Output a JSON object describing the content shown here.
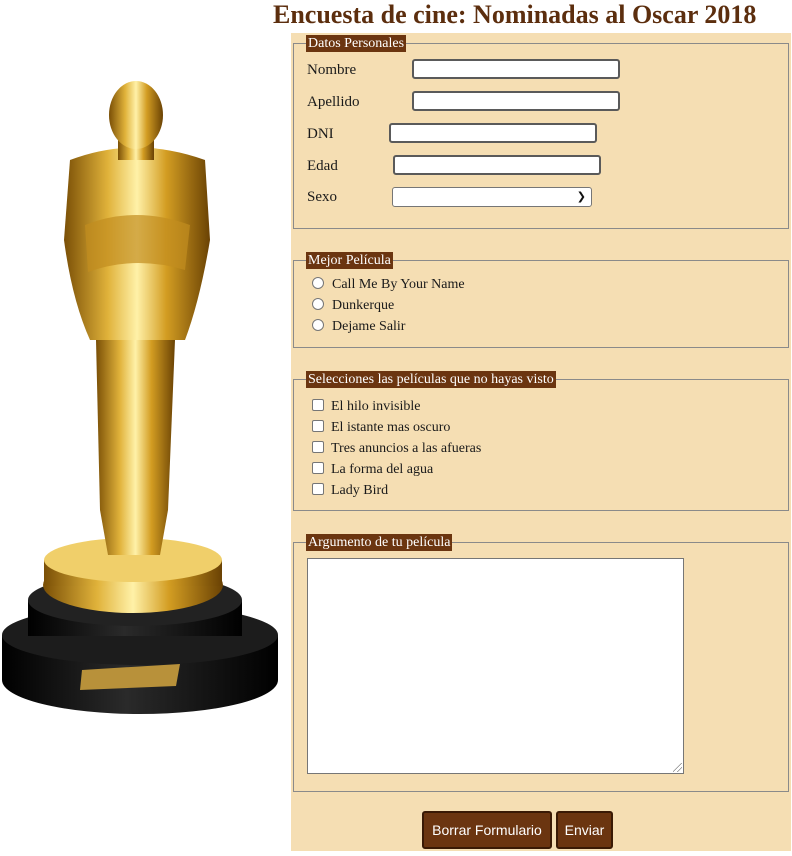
{
  "page": {
    "title": "Encuesta de cine: Nominadas al Oscar 2018"
  },
  "personal": {
    "legend": "Datos Personales",
    "nombre_label": "Nombre",
    "apellido_label": "Apellido",
    "dni_label": "DNI",
    "edad_label": "Edad",
    "sexo_label": "Sexo",
    "nombre_value": "",
    "apellido_value": "",
    "dni_value": "",
    "edad_value": "",
    "sexo_value": ""
  },
  "best_movie": {
    "legend": "Mejor Película",
    "options": [
      "Call Me By Your Name",
      "Dunkerque",
      "Dejame Salir"
    ]
  },
  "not_seen": {
    "legend": "Selecciones las películas que no hayas visto",
    "options": [
      "El hilo invisible",
      "El istante mas oscuro",
      "Tres anuncios a las afueras",
      "La forma del agua",
      "Lady Bird"
    ]
  },
  "plot": {
    "legend": "Argumento de tu película",
    "value": ""
  },
  "buttons": {
    "reset_label": "Borrar Formulario",
    "submit_label": "Enviar"
  },
  "icons": {
    "select_arrow": "chevron-down-icon"
  },
  "colors": {
    "title": "#5c2e0e",
    "panel_bg": "#f5deb3",
    "legend_bg": "#6b3510",
    "button_bg": "#6b3510"
  }
}
